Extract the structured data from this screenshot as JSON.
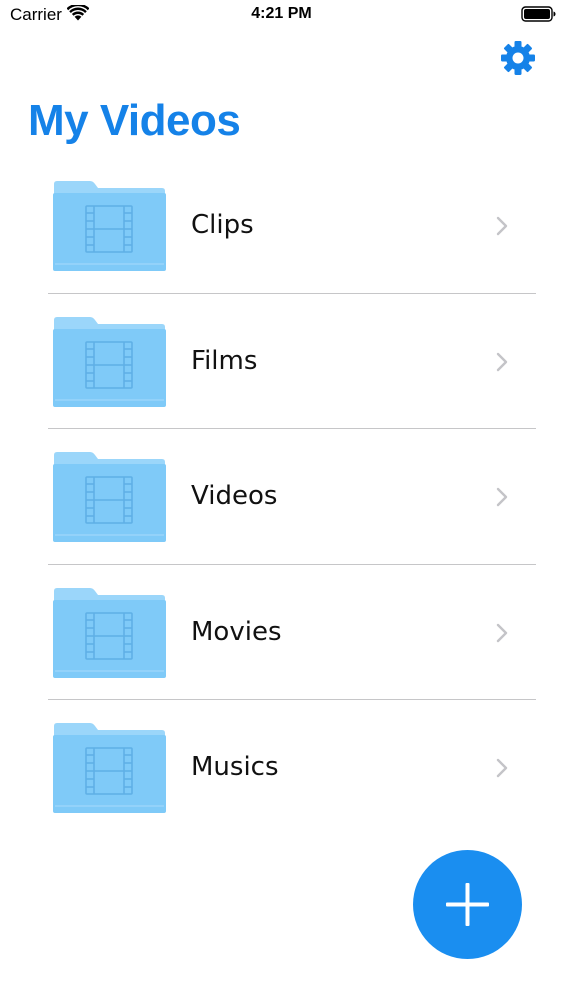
{
  "status_bar": {
    "carrier": "Carrier",
    "time": "4:21 PM",
    "wifi_icon": "wifi-icon",
    "battery_icon": "battery-icon"
  },
  "nav": {
    "settings_icon": "gear-icon"
  },
  "page": {
    "title": "My Videos"
  },
  "folders": [
    {
      "label": "Clips",
      "icon": "video-folder-icon"
    },
    {
      "label": "Films",
      "icon": "video-folder-icon"
    },
    {
      "label": "Videos",
      "icon": "video-folder-icon"
    },
    {
      "label": "Movies",
      "icon": "video-folder-icon"
    },
    {
      "label": "Musics",
      "icon": "video-folder-icon"
    }
  ],
  "fab": {
    "icon": "plus-icon"
  },
  "colors": {
    "accent": "#1582e8",
    "fab": "#1a8ef0",
    "folder": "#7fcaf8",
    "folder_tab": "#9bd6fa",
    "divider": "#c6c6c8",
    "chevron": "#c4c4c8"
  }
}
